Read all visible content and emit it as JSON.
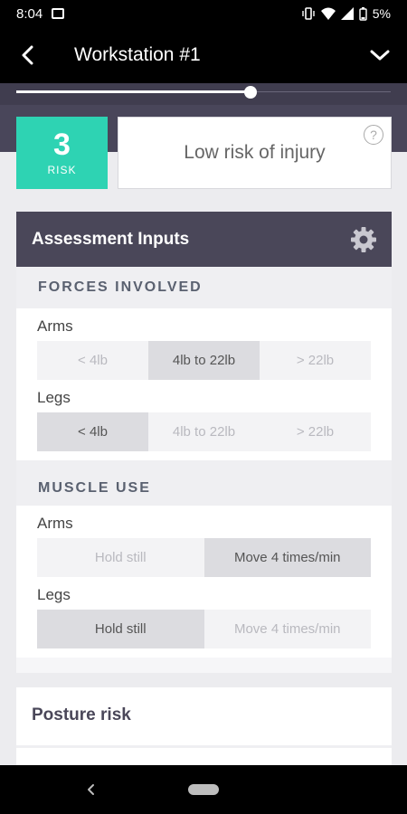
{
  "status_bar": {
    "time": "8:04",
    "battery": "5%"
  },
  "app_bar": {
    "title": "Workstation #1"
  },
  "slider": {
    "value_fraction": 0.63
  },
  "risk": {
    "score": "3",
    "label": "RISK",
    "description": "Low risk of injury",
    "help_symbol": "?"
  },
  "assessment": {
    "title": "Assessment Inputs",
    "sections": [
      {
        "title": "FORCES INVOLVED",
        "rows": [
          {
            "label": "Arms",
            "options": [
              "< 4lb",
              "4lb to 22lb",
              "> 22lb"
            ],
            "selected": 1
          },
          {
            "label": "Legs",
            "options": [
              "< 4lb",
              "4lb to 22lb",
              "> 22lb"
            ],
            "selected": 0
          }
        ]
      },
      {
        "title": "MUSCLE USE",
        "rows": [
          {
            "label": "Arms",
            "options": [
              "Hold still",
              "Move 4 times/min"
            ],
            "selected": 1
          },
          {
            "label": "Legs",
            "options": [
              "Hold still",
              "Move 4 times/min"
            ],
            "selected": 0
          }
        ]
      }
    ]
  },
  "posture": {
    "title": "Posture risk"
  },
  "colors": {
    "risk_accent": "#2ed3b3",
    "header_bg": "#4a4759"
  },
  "icons": [
    "back-arrow-icon",
    "chevron-down-icon",
    "help-icon",
    "gear-icon",
    "nav-back-icon",
    "home-pill-icon"
  ]
}
